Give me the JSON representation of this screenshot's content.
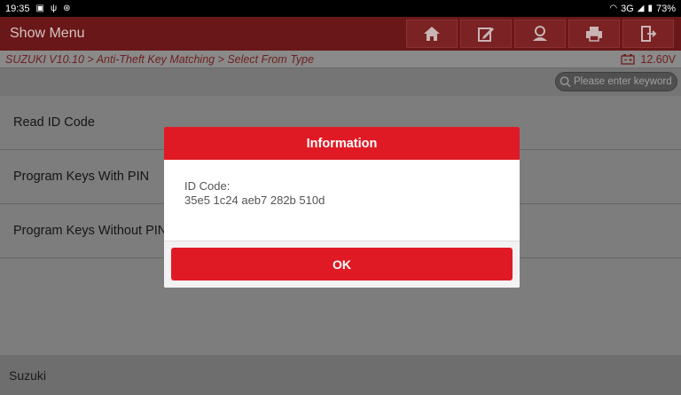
{
  "statusbar": {
    "time": "19:35",
    "network": "3G",
    "battery": "73%"
  },
  "titlebar": {
    "title": "Show Menu",
    "buttons": [
      "home-icon",
      "edit-icon",
      "user-icon",
      "printer-icon",
      "exit-icon"
    ]
  },
  "breadcrumb": {
    "path": "SUZUKI V10.10 > Anti-Theft Key Matching > Select From Type",
    "voltage": "12.60V"
  },
  "search": {
    "placeholder": "Please enter keyword"
  },
  "list": {
    "items": [
      {
        "label": "Read ID Code"
      },
      {
        "label": "Program Keys With PIN"
      },
      {
        "label": "Program Keys Without PIN"
      },
      {
        "label": ""
      }
    ]
  },
  "footer": {
    "label": "Suzuki"
  },
  "dialog": {
    "title": "Information",
    "line1": "ID Code:",
    "line2": "35e5 1c24 aeb7 282b 510d",
    "ok_label": "OK"
  },
  "colors": {
    "title_bar": "#6a1719",
    "accent_red": "#e01a24",
    "overlay_gray": "#7d7d7d"
  }
}
